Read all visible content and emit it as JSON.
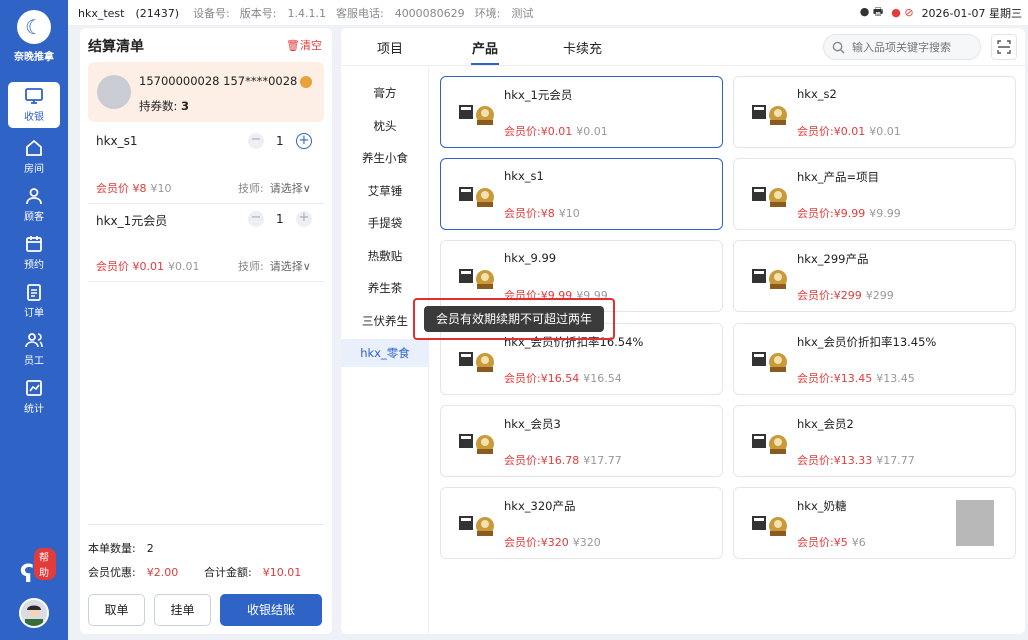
{
  "brand": {
    "logo_text": "奈晚推拿"
  },
  "nav": {
    "items": [
      {
        "label": "收银",
        "icon": "monitor-icon",
        "active": true
      },
      {
        "label": "房间",
        "icon": "home-icon"
      },
      {
        "label": "顾客",
        "icon": "user-icon"
      },
      {
        "label": "预约",
        "icon": "calendar-icon"
      },
      {
        "label": "订单",
        "icon": "clipboard-icon"
      },
      {
        "label": "员工",
        "icon": "staff-icon"
      },
      {
        "label": "统计",
        "icon": "chart-icon"
      }
    ],
    "help_label": "帮助"
  },
  "topbar": {
    "store": "hkx_test　(21437)",
    "device": "设备号:",
    "version": "版本号:　1.4.1.1",
    "service": "客服电话:　4000080629",
    "env": "环境:　测试",
    "datetime": "2026-01-07 星期三"
  },
  "cart": {
    "title": "结算清单",
    "clear_label": "清空",
    "member": {
      "phone": "15700000028 157****0028",
      "coupons_label": "持券数:",
      "coupons": "3"
    },
    "items": [
      {
        "name": "hkx_s1",
        "qty": "1",
        "price": "会员价 ¥8",
        "orig": "¥10",
        "tech_label": "技师:",
        "tech_value": "请选择∨"
      },
      {
        "name": "hkx_1元会员",
        "qty": "1",
        "price": "会员价 ¥0.01",
        "orig": "¥0.01",
        "tech_label": "技师:",
        "tech_value": "请选择∨"
      }
    ],
    "count_label": "本单数量:　2",
    "discount_label": "会员优惠:",
    "discount_value": "¥2.00",
    "total_label": "合计金额:",
    "total_value": "¥10.01",
    "btn_cancel": "取单",
    "btn_hold": "挂单",
    "btn_pay": "收银结账"
  },
  "tabs": [
    {
      "label": "项目"
    },
    {
      "label": "产品",
      "active": true
    },
    {
      "label": "卡续充"
    }
  ],
  "search": {
    "placeholder": "输入品项关键字搜索"
  },
  "categories": [
    "膏方",
    "枕头",
    "养生小食",
    "艾草锤",
    "手提袋",
    "热敷贴",
    "养生茶",
    "三伏养生",
    "hkx_零食"
  ],
  "active_category": "hkx_零食",
  "products": [
    {
      "name": "hkx_1元会员",
      "price": "会员价:¥0.01",
      "orig": "¥0.01",
      "selected": true
    },
    {
      "name": "hkx_s2",
      "price": "会员价:¥0.01",
      "orig": "¥0.01"
    },
    {
      "name": "hkx_s1",
      "price": "会员价:¥8",
      "orig": "¥10",
      "selected": true
    },
    {
      "name": "hkx_产品=项目",
      "price": "会员价:¥9.99",
      "orig": "¥9.99"
    },
    {
      "name": "hkx_9.99",
      "price": "会员价:¥9.99",
      "orig": "¥9.99"
    },
    {
      "name": "hkx_299产品",
      "price": "会员价:¥299",
      "orig": "¥299"
    },
    {
      "name": "hkx_会员价折扣率16.54%",
      "price": "会员价:¥16.54",
      "orig": "¥16.54"
    },
    {
      "name": "hkx_会员价折扣率13.45%",
      "price": "会员价:¥13.45",
      "orig": "¥13.45"
    },
    {
      "name": "hkx_会员3",
      "price": "会员价:¥16.78",
      "orig": "¥17.77"
    },
    {
      "name": "hkx_会员2",
      "price": "会员价:¥13.33",
      "orig": "¥17.77"
    },
    {
      "name": "hkx_320产品",
      "price": "会员价:¥320",
      "orig": "¥320"
    },
    {
      "name": "hkx_奶糖",
      "price": "会员价:¥5",
      "orig": "¥6"
    }
  ],
  "toast": {
    "message": "会员有效期续期不可超过两年"
  },
  "colors": {
    "primary": "#2f63c6",
    "price_red": "#e23b3b",
    "toast_border": "#e0302f"
  }
}
